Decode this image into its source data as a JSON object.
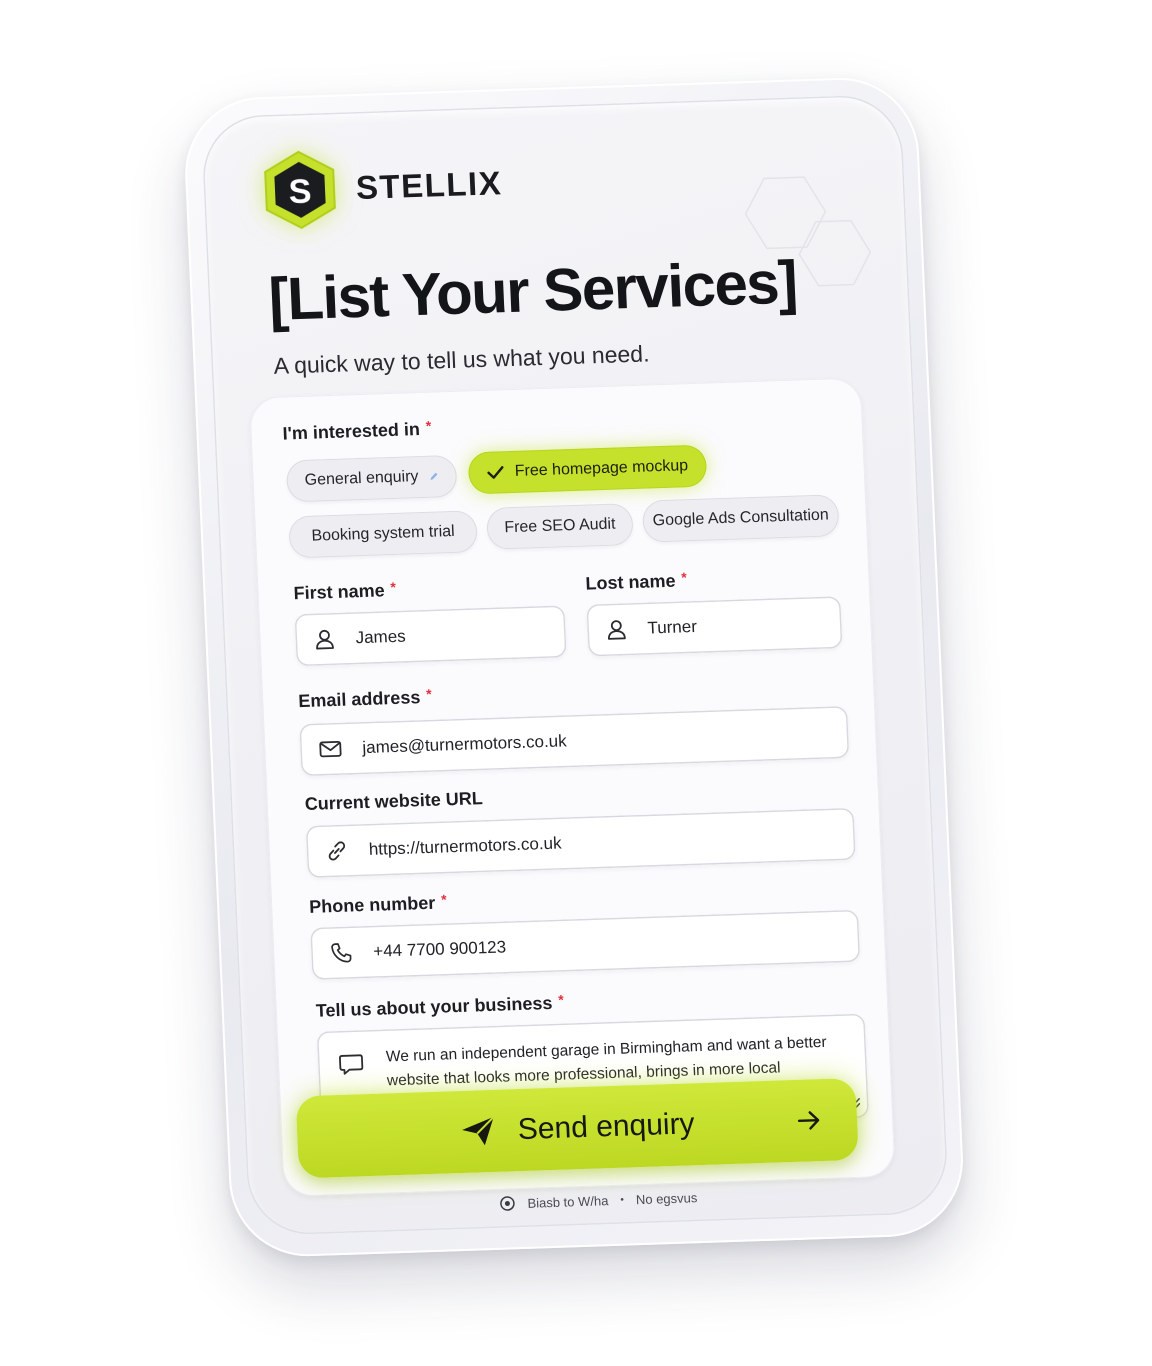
{
  "brand": {
    "name": "STELLIX",
    "logo_letter": "S",
    "accent_color": "#c5e12c"
  },
  "header": {
    "title": "[List Your Services]",
    "subtitle": "A quick way to tell us what you need."
  },
  "interests": {
    "label": "I'm interested in",
    "required_mark": "*",
    "options": [
      {
        "label": "General enquiry",
        "selected": false
      },
      {
        "label": "Free homepage mockup",
        "selected": true
      },
      {
        "label": "Booking system trial",
        "selected": false
      },
      {
        "label": "Free SEO Audit",
        "selected": false
      },
      {
        "label": "Google Ads Consultation",
        "selected": false
      }
    ]
  },
  "fields": {
    "first_name": {
      "label": "First name",
      "required_mark": "*",
      "value": "James",
      "icon": "user-icon"
    },
    "last_name": {
      "label": "Lost name",
      "required_mark": "*",
      "value": "Turner",
      "icon": "user-icon"
    },
    "email": {
      "label": "Email address",
      "required_mark": "*",
      "value": "james@turnermotors.co.uk",
      "icon": "mail-icon"
    },
    "website": {
      "label": "Current website URL",
      "value": "https://turnermotors.co.uk",
      "icon": "link-icon"
    },
    "phone": {
      "label": "Phone number",
      "required_mark": "*",
      "value": "+44 7700 900123",
      "icon": "phone-icon"
    },
    "business": {
      "label": "Tell us about your business",
      "required_mark": "*",
      "value": "We run an independent garage in Birmingham and want a better website that looks more professional, brings in more local enquiries and makes it easier for customers to book online.",
      "icon": "chat-icon"
    }
  },
  "submit": {
    "label": "Send enquiry",
    "icon": "paper-plane-icon",
    "trailing_icon": "arrow-right-icon"
  },
  "footnote": {
    "left": "Biasb to W/ha",
    "separator": "•",
    "right": "No egsvus"
  }
}
